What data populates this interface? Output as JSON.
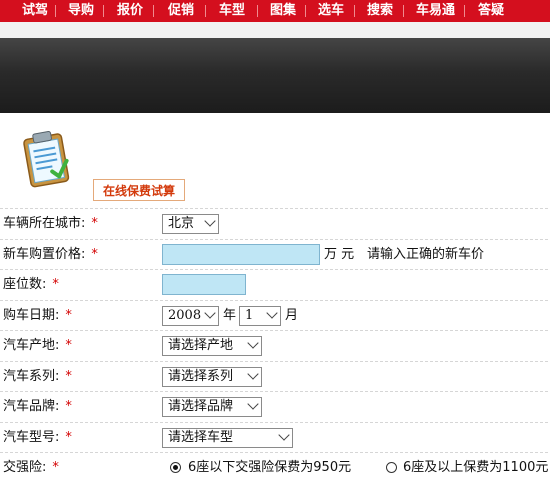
{
  "nav": {
    "items": [
      "试驾",
      "导购",
      "报价",
      "促销",
      "车型",
      "图集",
      "选车",
      "搜索",
      "车易通",
      "答疑"
    ]
  },
  "calc": {
    "title": "在线保费试算"
  },
  "form": {
    "required_mark": "*",
    "city": {
      "label": "车辆所在城市:",
      "value": "北京"
    },
    "price": {
      "label": "新车购置价格:",
      "value": "",
      "unit": "万 元",
      "hint": "请输入正确的新车价"
    },
    "seats": {
      "label": "座位数:",
      "value": ""
    },
    "purchase_date": {
      "label": "购车日期:",
      "year": "2008",
      "year_unit": "年",
      "month": "1",
      "month_unit": "月"
    },
    "origin": {
      "label": "汽车产地:",
      "value": "请选择产地"
    },
    "series": {
      "label": "汽车系列:",
      "value": "请选择系列"
    },
    "brand": {
      "label": "汽车品牌:",
      "value": "请选择品牌"
    },
    "model": {
      "label": "汽车型号:",
      "value": "请选择车型"
    },
    "compulsory": {
      "label": "交强险:",
      "option1": "6座以下交强险保费为950元",
      "option2": "6座及以上保费为1100元",
      "selected": 1
    }
  },
  "colors": {
    "nav_bg": "#d40f1e",
    "required": "#d30000",
    "input_bg": "#bfe6f5",
    "title_text": "#d33a0c"
  }
}
